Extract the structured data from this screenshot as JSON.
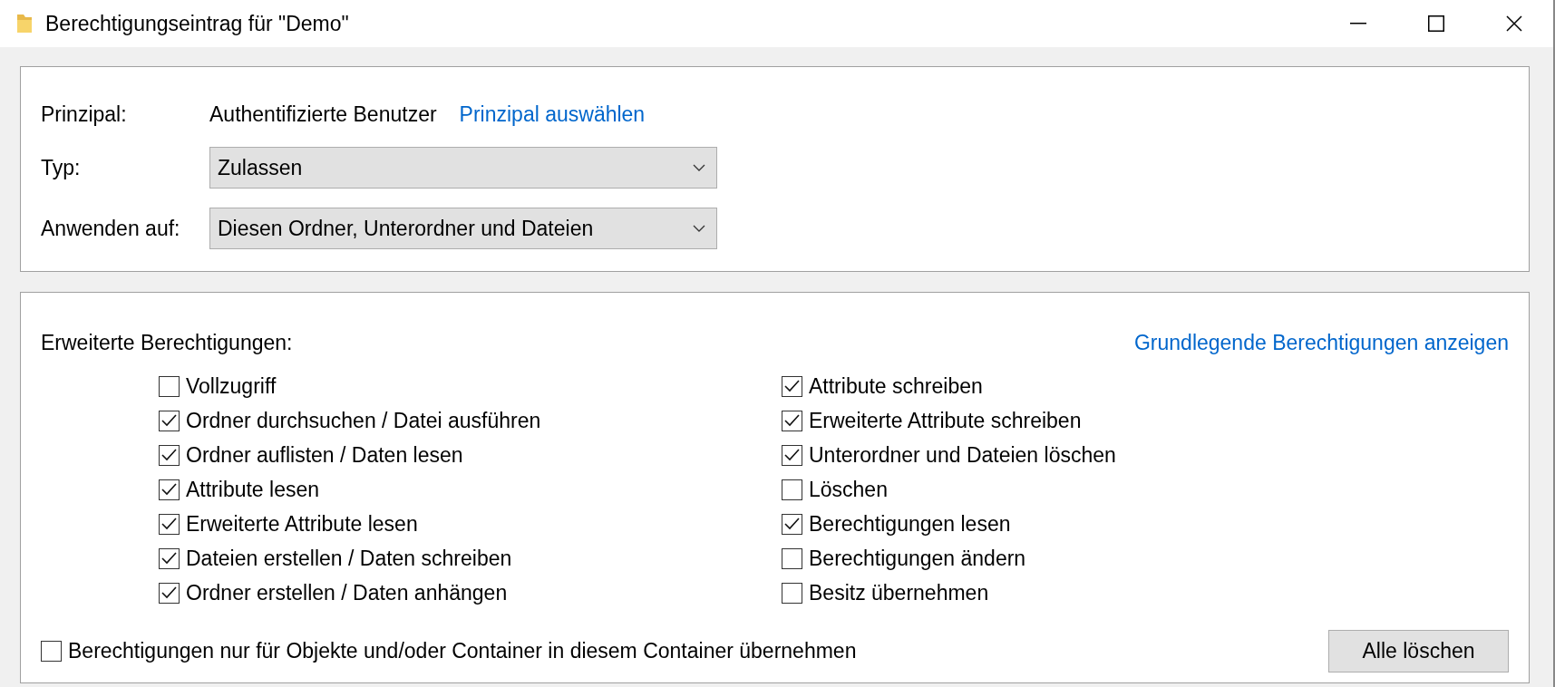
{
  "window": {
    "title": "Berechtigungseintrag für \"Demo\""
  },
  "principal": {
    "label": "Prinzipal:",
    "value": "Authentifizierte Benutzer",
    "link": "Prinzipal auswählen"
  },
  "fields": [
    {
      "label": "Typ:",
      "value": "Zulassen"
    },
    {
      "label": "Anwenden auf:",
      "value": "Diesen Ordner, Unterordner und Dateien"
    }
  ],
  "permissions": {
    "label": "Erweiterte Berechtigungen:",
    "link": "Grundlegende Berechtigungen anzeigen",
    "items": [
      {
        "label": "Vollzugriff",
        "checked": false
      },
      {
        "label": "Ordner durchsuchen / Datei ausführen",
        "checked": true
      },
      {
        "label": "Ordner auflisten / Daten lesen",
        "checked": true
      },
      {
        "label": "Attribute lesen",
        "checked": true
      },
      {
        "label": "Erweiterte Attribute lesen",
        "checked": true
      },
      {
        "label": "Dateien erstellen / Daten schreiben",
        "checked": true
      },
      {
        "label": "Ordner erstellen / Daten anhängen",
        "checked": true
      },
      {
        "label": "Attribute schreiben",
        "checked": true
      },
      {
        "label": "Erweiterte Attribute schreiben",
        "checked": true
      },
      {
        "label": "Unterordner und Dateien löschen",
        "checked": true
      },
      {
        "label": "Löschen",
        "checked": false
      },
      {
        "label": "Berechtigungen lesen",
        "checked": true
      },
      {
        "label": "Berechtigungen ändern",
        "checked": false
      },
      {
        "label": "Besitz übernehmen",
        "checked": false
      }
    ]
  },
  "inherit_only": {
    "label": "Berechtigungen nur für Objekte und/oder Container in diesem Container übernehmen",
    "checked": false
  },
  "clear_button": "Alle löschen"
}
